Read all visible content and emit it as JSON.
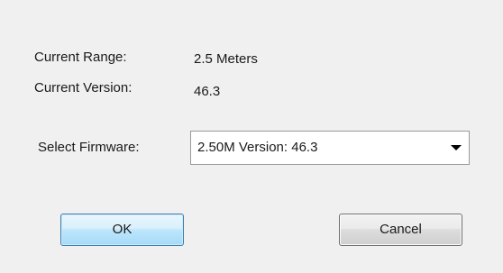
{
  "info": {
    "range_label": "Current Range:",
    "range_value": "2.5 Meters",
    "version_label": "Current Version:",
    "version_value": "46.3"
  },
  "firmware": {
    "label": "Select Firmware:",
    "selected": "2.50M  Version: 46.3",
    "arrow_icon": "chevron-down-icon"
  },
  "buttons": {
    "ok_label": "OK",
    "cancel_label": "Cancel"
  },
  "colors": {
    "dialog_background": "#f0f0f0",
    "ok_border": "#3c7fb1",
    "ok_fill": "#bee6fd",
    "cancel_border": "#707070"
  }
}
